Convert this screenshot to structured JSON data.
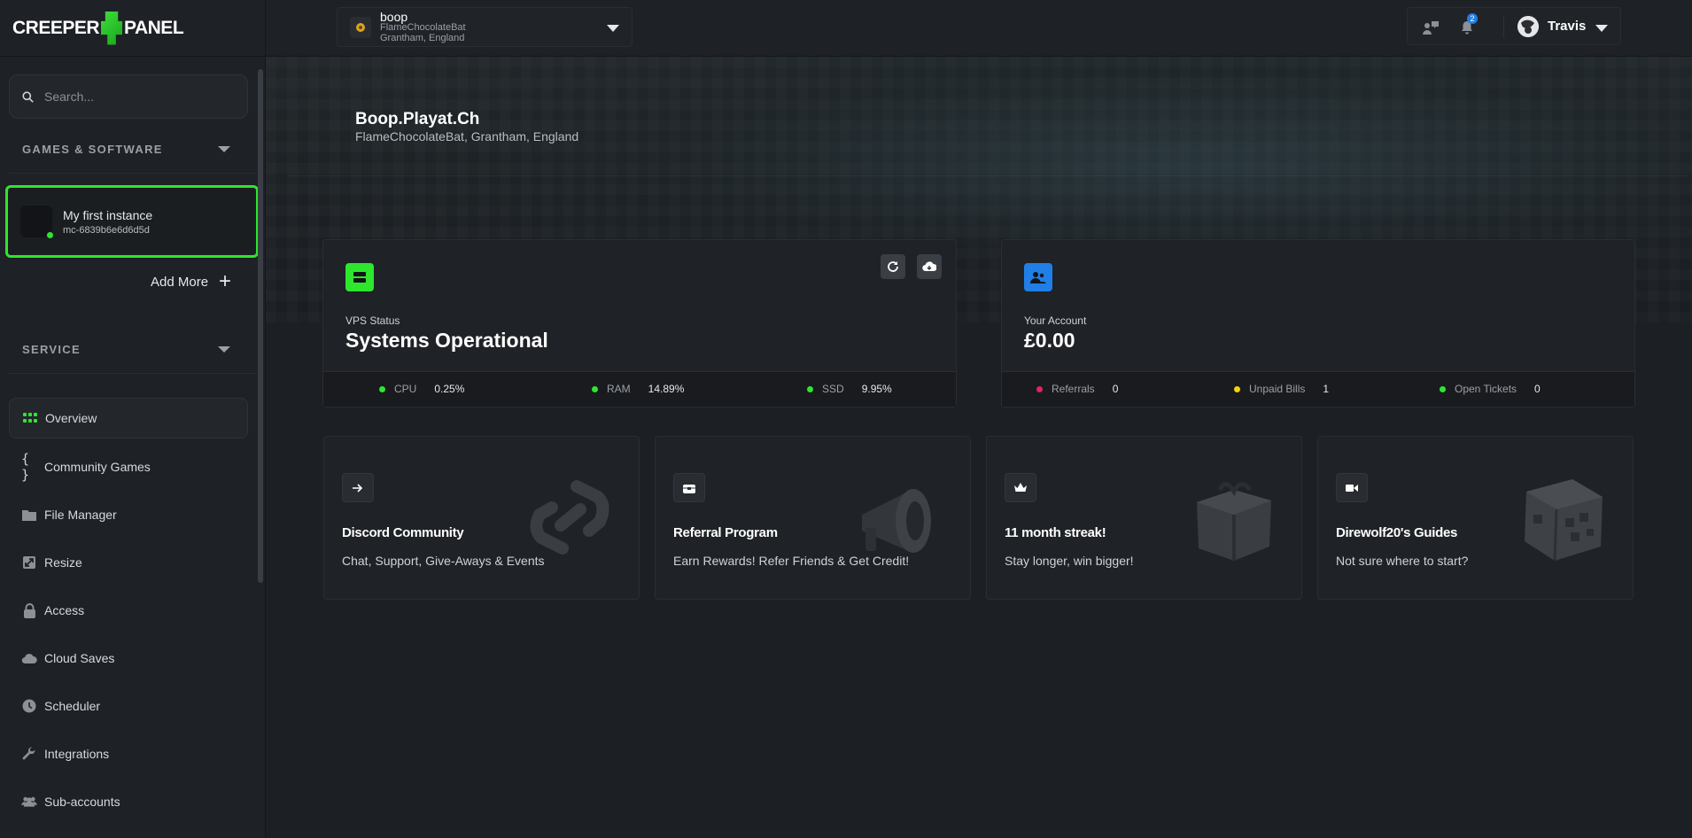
{
  "brand": {
    "logo_left": "CREEPER",
    "logo_right": "PANEL"
  },
  "sidebar": {
    "search_placeholder": "Search...",
    "section_games": "GAMES & SOFTWARE",
    "instance": {
      "name": "My first instance",
      "id": "mc-6839b6e6d6d5d",
      "status_color": "#2ee62e"
    },
    "add_more": "Add More",
    "section_service": "SERVICE",
    "nav": [
      {
        "label": "Overview",
        "icon": "grid-icon"
      },
      {
        "label": "Community Games",
        "icon": "braces-icon"
      },
      {
        "label": "File Manager",
        "icon": "folder-icon"
      },
      {
        "label": "Resize",
        "icon": "resize-icon"
      },
      {
        "label": "Access",
        "icon": "lock-icon"
      },
      {
        "label": "Cloud Saves",
        "icon": "cloud-icon"
      },
      {
        "label": "Scheduler",
        "icon": "clock-icon"
      },
      {
        "label": "Integrations",
        "icon": "wrench-icon"
      },
      {
        "label": "Sub-accounts",
        "icon": "users-icon"
      }
    ]
  },
  "topbar": {
    "server": {
      "name": "boop",
      "owner": "FlameChocolateBat",
      "location": "Grantham, England"
    },
    "notifications_count": "2",
    "username": "Travis"
  },
  "main": {
    "title": "Boop.Playat.Ch",
    "subtitle": "FlameChocolateBat, Grantham, England",
    "vps": {
      "label": "VPS Status",
      "value": "Systems Operational",
      "accent": "#2ee62e",
      "stats": [
        {
          "key": "CPU",
          "value": "0.25%",
          "color": "#2ee62e"
        },
        {
          "key": "RAM",
          "value": "14.89%",
          "color": "#2ee62e"
        },
        {
          "key": "SSD",
          "value": "9.95%",
          "color": "#2ee62e"
        }
      ]
    },
    "account": {
      "label": "Your Account",
      "value": "£0.00",
      "accent": "#1f7fe6",
      "stats": [
        {
          "key": "Referrals",
          "value": "0",
          "color": "#e0245e"
        },
        {
          "key": "Unpaid Bills",
          "value": "1",
          "color": "#f5d20a"
        },
        {
          "key": "Open Tickets",
          "value": "0",
          "color": "#2ee62e"
        }
      ]
    },
    "promos": [
      {
        "title": "Discord Community",
        "desc": "Chat, Support, Give-Aways & Events",
        "icon": "arrow-right-icon"
      },
      {
        "title": "Referral Program",
        "desc": "Earn Rewards! Refer Friends & Get Credit!",
        "icon": "treasure-icon"
      },
      {
        "title": "11 month streak!",
        "desc": "Stay longer, win bigger!",
        "icon": "crown-icon"
      },
      {
        "title": "Direwolf20's Guides",
        "desc": "Not sure where to start?",
        "icon": "video-icon"
      }
    ]
  }
}
